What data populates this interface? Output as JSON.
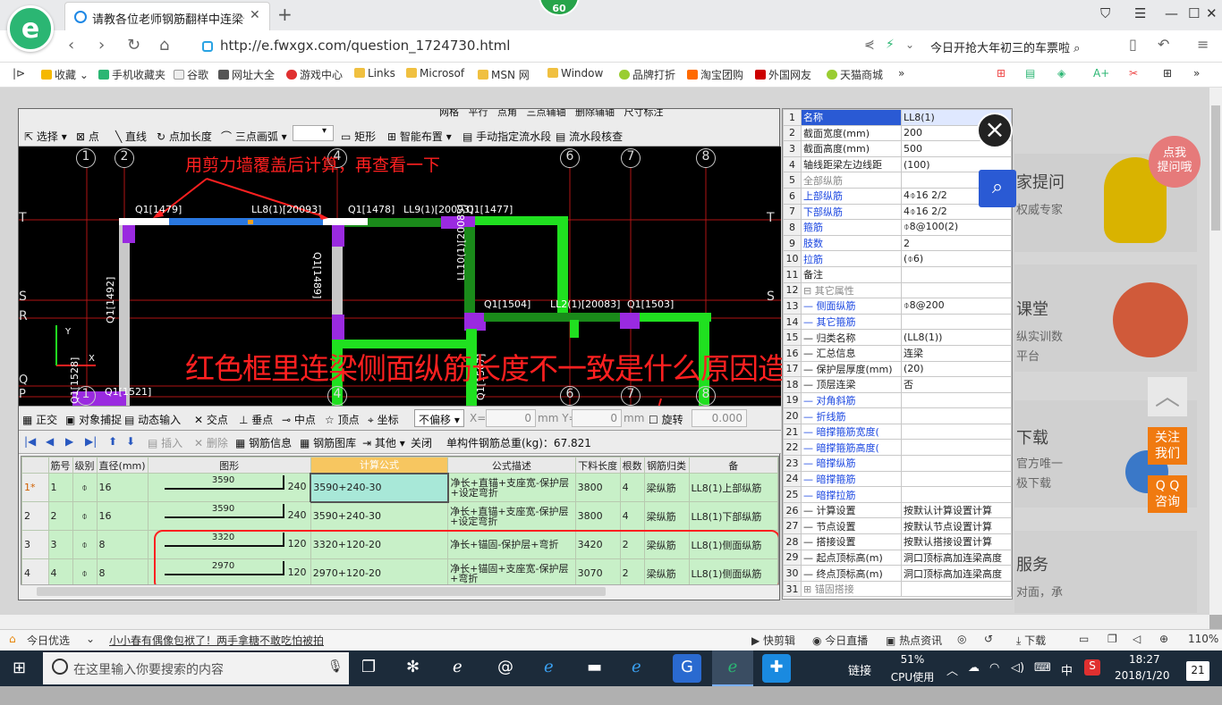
{
  "browser": {
    "badge": "60",
    "tab_title": "请教各位老师钢筋翻样中连梁侧面",
    "tab_close": "✕",
    "new_tab": "+",
    "url": "http://e.fwxgx.com/question_1724730.html",
    "search_text": "今日开抢大年初三的车票啦",
    "bookmarks": [
      "收藏",
      "手机收藏夹",
      "谷歌",
      "网址大全",
      "游戏中心",
      "Links",
      "Microsof",
      "MSN 网",
      "Window",
      "品牌打折",
      "淘宝团购",
      "外国网友",
      "天猫商城"
    ],
    "bookmark_more": "»"
  },
  "site_side": {
    "card1_title": "家提问",
    "card1_sub": "权威专家",
    "sticker": "点我\n提问哦",
    "card2_title": "课堂",
    "card2_sub1": "纵实训数",
    "card2_sub2": "平台",
    "card3_title": "下载",
    "card3_sub1": "官方唯一",
    "card3_sub2": "极下载",
    "card4_title": "服务",
    "card4_sub": "对面，承",
    "follow": "关注\n我们",
    "qq": "Q Q\n咨询"
  },
  "cad": {
    "toolbar1": [
      "网格",
      "平行",
      "点角",
      "三点辅轴",
      "删除辅轴",
      "尺寸标注"
    ],
    "toolbar2": [
      "选择",
      "点",
      "直线",
      "点加长度",
      "三点画弧",
      "矩形",
      "智能布置",
      "手动指定流水段",
      "流水段核查"
    ],
    "annotation_top": "用剪力墙覆盖后计算，再查看一下",
    "annotation_main": "红色框里连梁侧面纵筋长度不一致是什么原因造成的？",
    "axis_top": [
      "1",
      "2",
      "4",
      "6",
      "7",
      "8"
    ],
    "axis_bottom": [
      "1",
      "4",
      "6",
      "7",
      "8"
    ],
    "axis_left": [
      "T",
      "S",
      "R",
      "Q",
      "P"
    ],
    "axis_right": [
      "T",
      "S"
    ],
    "labels": [
      "Q1[1479]",
      "LL8(1)[20093]",
      "Q1[1478]",
      "LL9(1)[20093]",
      "Q1[1477]",
      "Q1[1489]",
      "Q1[1492]",
      "LL10(1)[20085]",
      "Q1[1504]",
      "LL2(1)[20083]",
      "Q1[1503]",
      "Q1[1507]",
      "Q1[1521]",
      "Q1[1528]"
    ],
    "toolbar3": [
      "正交",
      "对象捕捉",
      "动态输入",
      "交点",
      "垂点",
      "中点",
      "顶点",
      "坐标",
      "不偏移",
      "X=",
      "0",
      "mm Y=",
      "0",
      "mm",
      "旋转",
      "0.000"
    ],
    "toolbar4": [
      "插入",
      "删除",
      "钢筋信息",
      "钢筋图库",
      "其他",
      "关闭"
    ],
    "total_weight": "单构件钢筋总重(kg)：67.821",
    "grid_headers": [
      "筋号",
      "级别",
      "直径(mm)",
      "图形",
      "计算公式",
      "公式描述",
      "下料长度",
      "根数",
      "钢筋归类",
      "备"
    ],
    "grid_rows": [
      {
        "row": "1*",
        "no": "1",
        "level": "⌽",
        "dia": "16",
        "shape_len": "3590",
        "hook": "240",
        "formula": "3590+240-30",
        "desc": "净长+直锚+支座宽-保护层+设定弯折",
        "length": "3800",
        "count": "4",
        "cat": "梁纵筋",
        "note": "LL8(1)上部纵筋"
      },
      {
        "row": "2",
        "no": "2",
        "level": "⌽",
        "dia": "16",
        "shape_len": "3590",
        "hook": "240",
        "formula": "3590+240-30",
        "desc": "净长+直锚+支座宽-保护层+设定弯折",
        "length": "3800",
        "count": "4",
        "cat": "梁纵筋",
        "note": "LL8(1)下部纵筋"
      },
      {
        "row": "3",
        "no": "3",
        "level": "⌽",
        "dia": "8",
        "shape_len": "3320",
        "hook": "120",
        "formula": "3320+120-20",
        "desc": "净长+锚固-保护层+弯折",
        "length": "3420",
        "count": "2",
        "cat": "梁纵筋",
        "note": "LL8(1)侧面纵筋"
      },
      {
        "row": "4",
        "no": "4",
        "level": "⌽",
        "dia": "8",
        "shape_len": "2970",
        "hook": "120",
        "formula": "2970+120-20",
        "desc": "净长+锚固+支座宽-保护层+弯折",
        "length": "3070",
        "count": "2",
        "cat": "梁纵筋",
        "note": "LL8(1)侧面纵筋"
      }
    ]
  },
  "props": [
    {
      "n": "1",
      "k": "名称",
      "v": "LL8(1)",
      "cls": ""
    },
    {
      "n": "2",
      "k": "截面宽度(mm)",
      "v": "200",
      "cls": ""
    },
    {
      "n": "3",
      "k": "截面高度(mm)",
      "v": "500",
      "cls": ""
    },
    {
      "n": "4",
      "k": "轴线距梁左边线距",
      "v": "(100)",
      "cls": ""
    },
    {
      "n": "5",
      "k": "全部纵筋",
      "v": "",
      "cls": "gray"
    },
    {
      "n": "6",
      "k": "上部纵筋",
      "v": "4⌽16 2/2",
      "cls": "blue"
    },
    {
      "n": "7",
      "k": "下部纵筋",
      "v": "4⌽16 2/2",
      "cls": "blue"
    },
    {
      "n": "8",
      "k": "箍筋",
      "v": "⌽8@100(2)",
      "cls": "blue"
    },
    {
      "n": "9",
      "k": "肢数",
      "v": "2",
      "cls": "blue"
    },
    {
      "n": "10",
      "k": "拉筋",
      "v": "(⌽6)",
      "cls": "blue"
    },
    {
      "n": "11",
      "k": "备注",
      "v": "",
      "cls": ""
    },
    {
      "n": "12",
      "k": "⊟ 其它属性",
      "v": "",
      "cls": "gray"
    },
    {
      "n": "13",
      "k": "— 侧面纵筋",
      "v": "⌽8@200",
      "cls": "blue"
    },
    {
      "n": "14",
      "k": "— 其它箍筋",
      "v": "",
      "cls": "blue"
    },
    {
      "n": "15",
      "k": "— 归类名称",
      "v": "(LL8(1))",
      "cls": ""
    },
    {
      "n": "16",
      "k": "— 汇总信息",
      "v": "连梁",
      "cls": ""
    },
    {
      "n": "17",
      "k": "— 保护层厚度(mm)",
      "v": "(20)",
      "cls": ""
    },
    {
      "n": "18",
      "k": "— 顶层连梁",
      "v": "否",
      "cls": ""
    },
    {
      "n": "19",
      "k": "— 对角斜筋",
      "v": "",
      "cls": "blue"
    },
    {
      "n": "20",
      "k": "— 折线筋",
      "v": "",
      "cls": "blue"
    },
    {
      "n": "21",
      "k": "— 暗撑箍筋宽度(",
      "v": "",
      "cls": "blue"
    },
    {
      "n": "22",
      "k": "— 暗撑箍筋高度(",
      "v": "",
      "cls": "blue"
    },
    {
      "n": "23",
      "k": "— 暗撑纵筋",
      "v": "",
      "cls": "blue"
    },
    {
      "n": "24",
      "k": "— 暗撑箍筋",
      "v": "",
      "cls": "blue"
    },
    {
      "n": "25",
      "k": "— 暗撑拉筋",
      "v": "",
      "cls": "blue"
    },
    {
      "n": "26",
      "k": "— 计算设置",
      "v": "按默认计算设置计算",
      "cls": ""
    },
    {
      "n": "27",
      "k": "— 节点设置",
      "v": "按默认节点设置计算",
      "cls": ""
    },
    {
      "n": "28",
      "k": "— 搭接设置",
      "v": "按默认搭接设置计算",
      "cls": ""
    },
    {
      "n": "29",
      "k": "— 起点顶标高(m)",
      "v": "洞口顶标高加连梁高度",
      "cls": ""
    },
    {
      "n": "30",
      "k": "— 终点顶标高(m)",
      "v": "洞口顶标高加连梁高度",
      "cls": ""
    },
    {
      "n": "31",
      "k": "⊞ 锚固搭接",
      "v": "",
      "cls": "gray"
    }
  ],
  "statusbar": {
    "left1": "今日优选",
    "left2": "小小春有偶像包袱了！两手拿糖不敢吃怕被拍",
    "right": [
      "快剪辑",
      "今日直播",
      "热点资讯",
      "下载",
      "110%"
    ]
  },
  "taskbar": {
    "search": "在这里输入你要搜索的内容",
    "link": "链接",
    "cpu": "51%",
    "cpu_label": "CPU使用",
    "ime": "中",
    "time": "18:27",
    "date": "2018/1/20",
    "notif": "21"
  }
}
